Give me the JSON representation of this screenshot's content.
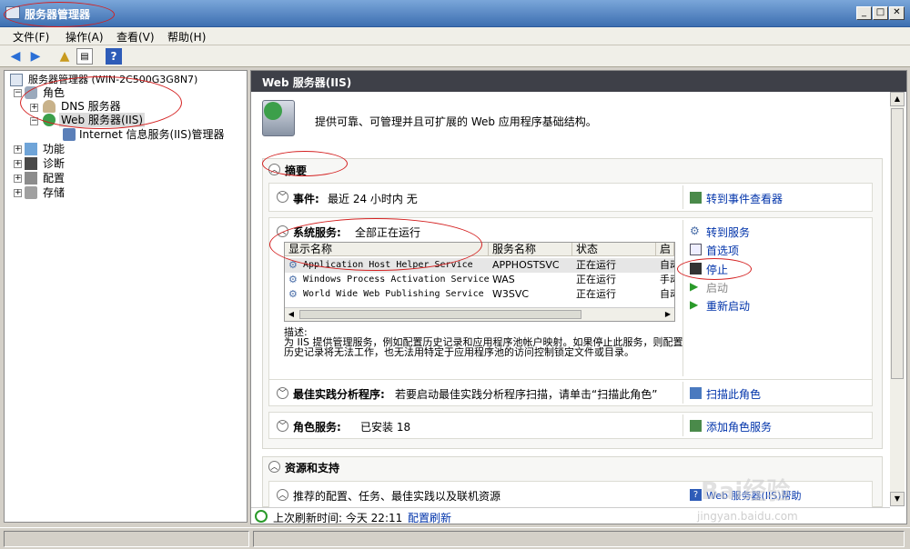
{
  "window": {
    "title": "服务器管理器"
  },
  "menu": [
    "文件(F)",
    "操作(A)",
    "查看(V)",
    "帮助(H)"
  ],
  "tree": {
    "root": "服务器管理器 (WIN-2C500G3G8N7)",
    "roles": "角色",
    "dns": "DNS 服务器",
    "web": "Web 服务器(IIS)",
    "iis_manager": "Internet 信息服务(IIS)管理器",
    "features": "功能",
    "diagnostics": "诊断",
    "configuration": "配置",
    "storage": "存储"
  },
  "content": {
    "header": "Web 服务器(IIS)",
    "description": "提供可靠、可管理并且可扩展的 Web 应用程序基础结构。",
    "summary": {
      "title": "摘要",
      "events_label": "事件:",
      "events_value": "最近 24 小时内 无",
      "events_link": "转到事件查看器",
      "services_label": "系统服务:",
      "services_value": "全部正在运行",
      "columns": [
        "显示名称",
        "服务名称",
        "状态",
        "启动"
      ],
      "rows": [
        {
          "name": "Application Host Helper Service",
          "service": "APPHOSTSVC",
          "status": "正在运行",
          "startup": "自动"
        },
        {
          "name": "Windows Process Activation Service",
          "service": "WAS",
          "status": "正在运行",
          "startup": "手动"
        },
        {
          "name": "World Wide Web Publishing Service",
          "service": "W3SVC",
          "status": "正在运行",
          "startup": "自动"
        }
      ],
      "service_actions": [
        "转到服务",
        "首选项",
        "停止",
        "启动",
        "重新启动"
      ],
      "desc_label": "描述:",
      "desc_text": "为 IIS 提供管理服务，例如配置历史记录和应用程序池帐户映射。如果停止此服务，则配置历史记录将无法工作，也无法用特定于应用程序池的访问控制锁定文件或目录。",
      "bpa_label": "最佳实践分析程序:",
      "bpa_value": "若要启动最佳实践分析程序扫描，请单击“扫描此角色”",
      "bpa_link": "扫描此角色",
      "role_services_label": "角色服务:",
      "role_services_value": "已安装 18",
      "role_services_link": "添加角色服务"
    },
    "resources": {
      "title": "资源和支持",
      "item": "推荐的配置、任务、最佳实践以及联机资源",
      "link": "Web 服务器(IIS)帮助"
    },
    "refresh": {
      "label": "上次刷新时间: 今天 22:11",
      "link": "配置刷新"
    }
  },
  "watermark": {
    "brand": "Bai",
    "suffix": "经验",
    "url": "jingyan.baidu.com"
  }
}
